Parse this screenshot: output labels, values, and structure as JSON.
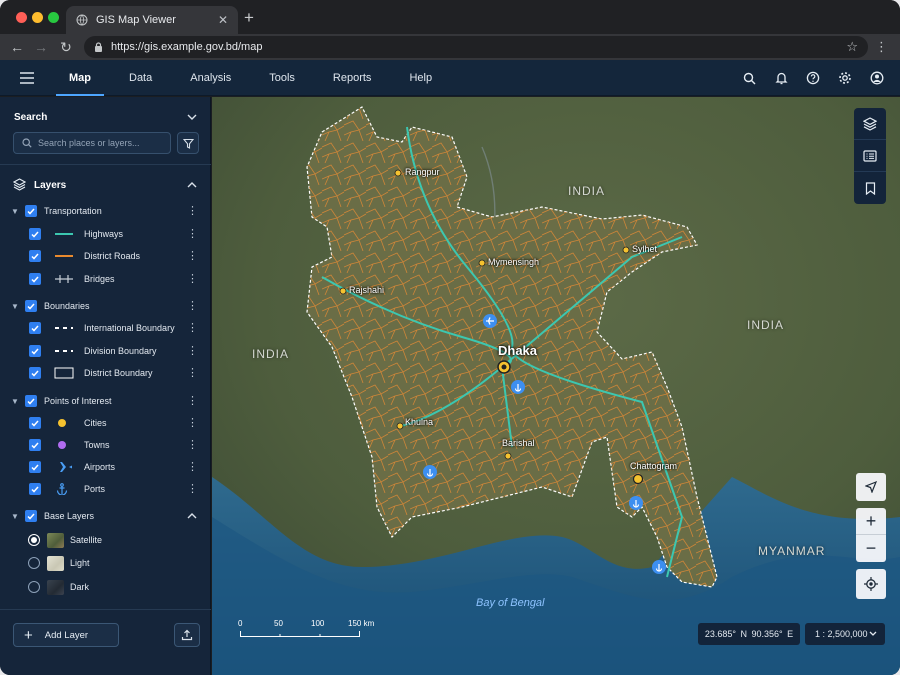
{
  "browser": {
    "tab_title": "GIS Map Viewer",
    "tab_close": "✕",
    "new_tab": "+",
    "url": "https://gis.example.gov.bd/map"
  },
  "header": {
    "tabs": [
      {
        "label": "Map",
        "active": true
      },
      {
        "label": "Data"
      },
      {
        "label": "Analysis"
      },
      {
        "label": "Tools"
      },
      {
        "label": "Reports"
      },
      {
        "label": "Help"
      }
    ],
    "icons": [
      "search-icon",
      "bell-icon",
      "help-icon",
      "gear-icon",
      "account-icon"
    ]
  },
  "sidebar": {
    "search": {
      "title": "Search",
      "placeholder": "Search places or layers..."
    },
    "layers_title": "Layers",
    "groups": [
      {
        "label": "Transportation",
        "items": [
          {
            "label": "Highways",
            "symbol": "line",
            "color": "#3cc7b0"
          },
          {
            "label": "District Roads",
            "symbol": "line",
            "color": "#e98a2e"
          },
          {
            "label": "Bridges",
            "symbol": "bridge",
            "color": "#c7cfd8"
          }
        ]
      },
      {
        "label": "Boundaries",
        "items": [
          {
            "label": "International Boundary",
            "symbol": "dashed",
            "color": "#ffffff"
          },
          {
            "label": "Division Boundary",
            "symbol": "dashed",
            "color": "#ffffff"
          },
          {
            "label": "District Boundary",
            "symbol": "box",
            "color": "#ffffff"
          }
        ]
      },
      {
        "label": "Points of Interest",
        "items": [
          {
            "label": "Cities",
            "symbol": "dot",
            "color": "#f5c22f"
          },
          {
            "label": "Towns",
            "symbol": "dot",
            "color": "#b06cf0"
          },
          {
            "label": "Airports",
            "symbol": "plane",
            "color": "#4a9ef5"
          },
          {
            "label": "Ports",
            "symbol": "anchor",
            "color": "#4a9ef5"
          }
        ]
      }
    ],
    "base_layers": {
      "label": "Base Layers",
      "options": [
        {
          "label": "Satellite",
          "selected": true,
          "color": "#6c7a55"
        },
        {
          "label": "Light",
          "selected": false,
          "color": "#d9d8c9"
        },
        {
          "label": "Dark",
          "selected": false,
          "color": "#2c3440"
        }
      ]
    },
    "add_layer": "Add Layer"
  },
  "map": {
    "regions": [
      "INDIA",
      "INDIA",
      "INDIA",
      "MYANMAR"
    ],
    "sea": "Bay of Bengal",
    "cities": [
      "Rangpur",
      "Mymensingh",
      "Sylhet",
      "Rajshahi",
      "Dhaka",
      "Khulna",
      "Barishal",
      "Chattogram"
    ],
    "scale_ticks": [
      "0",
      "50",
      "100",
      "150 km"
    ],
    "coordinates": "23.685° N  90.356° E",
    "scale": "1 : 2,500,000"
  }
}
